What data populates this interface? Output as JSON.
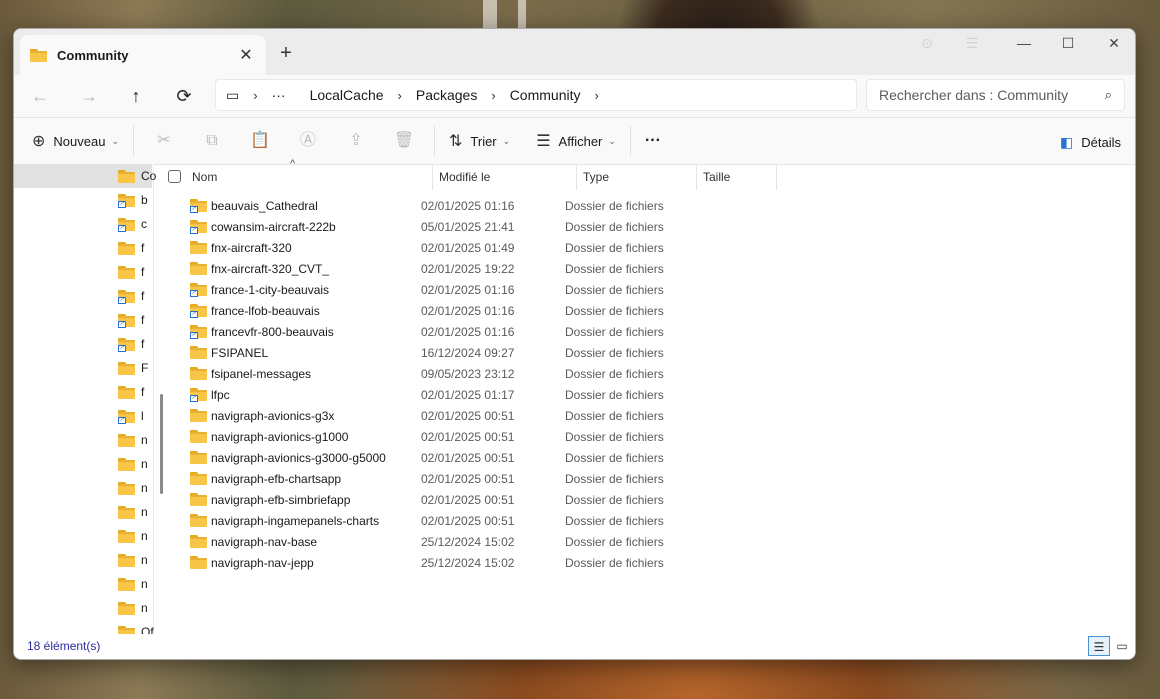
{
  "window": {
    "tab_title": "Community",
    "new_tab_label": "+",
    "controls": {
      "minimize": "—",
      "maximize": "☐",
      "close": "✕"
    }
  },
  "nav": {
    "back": "←",
    "forward": "→",
    "up": "↑",
    "refresh": "⟳"
  },
  "breadcrumb": {
    "overflow": "···",
    "items": [
      "LocalCache",
      "Packages",
      "Community"
    ]
  },
  "search": {
    "placeholder": "Rechercher dans : Community"
  },
  "commandbar": {
    "new_label": "Nouveau",
    "sort_label": "Trier",
    "view_label": "Afficher",
    "more_label": "···",
    "details_label": "Détails"
  },
  "navpane": {
    "items": [
      {
        "label": "Co",
        "link": false
      },
      {
        "label": "b",
        "link": true
      },
      {
        "label": "c",
        "link": true
      },
      {
        "label": "f",
        "link": false
      },
      {
        "label": "f",
        "link": false
      },
      {
        "label": "f",
        "link": true
      },
      {
        "label": "f",
        "link": true
      },
      {
        "label": "f",
        "link": true
      },
      {
        "label": "F",
        "link": false
      },
      {
        "label": "f",
        "link": false
      },
      {
        "label": "l",
        "link": true
      },
      {
        "label": "n",
        "link": false
      },
      {
        "label": "n",
        "link": false
      },
      {
        "label": "n",
        "link": false
      },
      {
        "label": "n",
        "link": false
      },
      {
        "label": "n",
        "link": false
      },
      {
        "label": "n",
        "link": false
      },
      {
        "label": "n",
        "link": false
      },
      {
        "label": "n",
        "link": false
      },
      {
        "label": "Of",
        "link": false
      }
    ]
  },
  "columns": {
    "name": "Nom",
    "modified": "Modifié le",
    "type": "Type",
    "size": "Taille"
  },
  "files": [
    {
      "name": "beauvais_Cathedral",
      "modified": "02/01/2025 01:16",
      "type": "Dossier de fichiers",
      "link": true
    },
    {
      "name": "cowansim-aircraft-222b",
      "modified": "05/01/2025 21:41",
      "type": "Dossier de fichiers",
      "link": true
    },
    {
      "name": "fnx-aircraft-320",
      "modified": "02/01/2025 01:49",
      "type": "Dossier de fichiers",
      "link": false
    },
    {
      "name": "fnx-aircraft-320_CVT_",
      "modified": "02/01/2025 19:22",
      "type": "Dossier de fichiers",
      "link": false
    },
    {
      "name": "france-1-city-beauvais",
      "modified": "02/01/2025 01:16",
      "type": "Dossier de fichiers",
      "link": true
    },
    {
      "name": "france-lfob-beauvais",
      "modified": "02/01/2025 01:16",
      "type": "Dossier de fichiers",
      "link": true
    },
    {
      "name": "francevfr-800-beauvais",
      "modified": "02/01/2025 01:16",
      "type": "Dossier de fichiers",
      "link": true
    },
    {
      "name": "FSIPANEL",
      "modified": "16/12/2024 09:27",
      "type": "Dossier de fichiers",
      "link": false
    },
    {
      "name": "fsipanel-messages",
      "modified": "09/05/2023 23:12",
      "type": "Dossier de fichiers",
      "link": false
    },
    {
      "name": "lfpc",
      "modified": "02/01/2025 01:17",
      "type": "Dossier de fichiers",
      "link": true
    },
    {
      "name": "navigraph-avionics-g3x",
      "modified": "02/01/2025 00:51",
      "type": "Dossier de fichiers",
      "link": false
    },
    {
      "name": "navigraph-avionics-g1000",
      "modified": "02/01/2025 00:51",
      "type": "Dossier de fichiers",
      "link": false
    },
    {
      "name": "navigraph-avionics-g3000-g5000",
      "modified": "02/01/2025 00:51",
      "type": "Dossier de fichiers",
      "link": false
    },
    {
      "name": "navigraph-efb-chartsapp",
      "modified": "02/01/2025 00:51",
      "type": "Dossier de fichiers",
      "link": false
    },
    {
      "name": "navigraph-efb-simbriefapp",
      "modified": "02/01/2025 00:51",
      "type": "Dossier de fichiers",
      "link": false
    },
    {
      "name": "navigraph-ingamepanels-charts",
      "modified": "02/01/2025 00:51",
      "type": "Dossier de fichiers",
      "link": false
    },
    {
      "name": "navigraph-nav-base",
      "modified": "25/12/2024 15:02",
      "type": "Dossier de fichiers",
      "link": false
    },
    {
      "name": "navigraph-nav-jepp",
      "modified": "25/12/2024 15:02",
      "type": "Dossier de fichiers",
      "link": false
    }
  ],
  "status": {
    "count_text": "18 élément(s)"
  }
}
